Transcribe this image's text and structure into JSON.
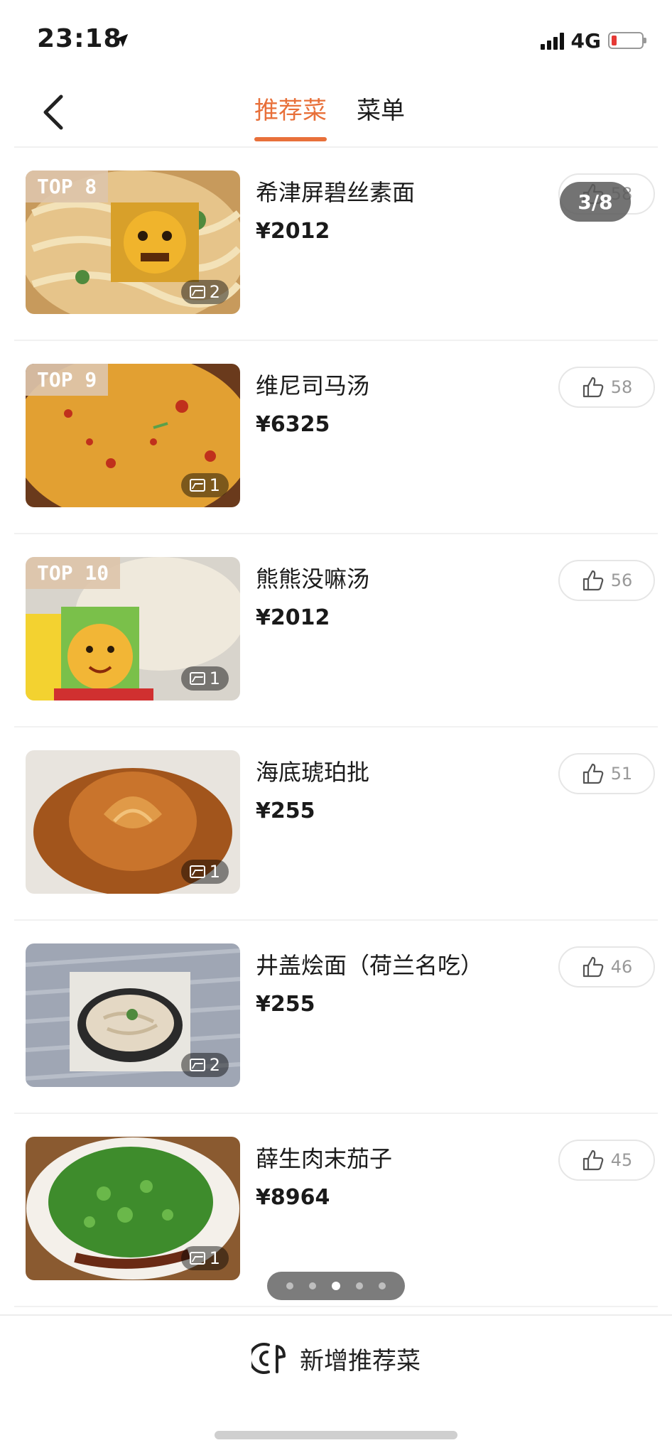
{
  "status_bar": {
    "time": "23:18",
    "network": "4G"
  },
  "header": {
    "tabs": [
      {
        "label": "推荐菜",
        "active": true
      },
      {
        "label": "菜单",
        "active": false
      }
    ]
  },
  "image_counter": "3/8",
  "dishes": [
    {
      "badge": "TOP 8",
      "name": "希津屏碧丝素面",
      "price": "¥2012",
      "images": "2",
      "likes": "58"
    },
    {
      "badge": "TOP 9",
      "name": "维尼司马汤",
      "price": "¥6325",
      "images": "1",
      "likes": "58"
    },
    {
      "badge": "TOP 10",
      "name": "熊熊没嘛汤",
      "price": "¥2012",
      "images": "1",
      "likes": "56"
    },
    {
      "badge": "",
      "name": "海底琥珀批",
      "price": "¥255",
      "images": "1",
      "likes": "51"
    },
    {
      "badge": "",
      "name": "井盖烩面（荷兰名吃）",
      "price": "¥255",
      "images": "2",
      "likes": "46"
    },
    {
      "badge": "",
      "name": "薛生肉末茄子",
      "price": "¥8964",
      "images": "1",
      "likes": "45"
    }
  ],
  "pagination": {
    "count": 5,
    "active_index": 2
  },
  "bottom_action": {
    "label": "新增推荐菜"
  },
  "colors": {
    "accent": "#e8703a",
    "like_border": "#e6e6e6",
    "price": "#1a1a1a"
  }
}
